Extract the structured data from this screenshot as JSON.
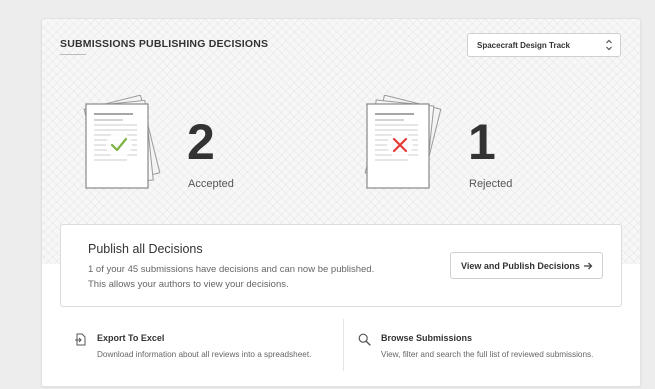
{
  "panel": {
    "title": "SUBMISSIONS PUBLISHING DECISIONS",
    "track_select": {
      "selected": "Spacecraft Design Track"
    }
  },
  "stats": {
    "accepted": {
      "count": "2",
      "label": "Accepted",
      "icon": "document-check-icon",
      "color": "#7cb342"
    },
    "rejected": {
      "count": "1",
      "label": "Rejected",
      "icon": "document-x-icon",
      "color": "#e53935"
    }
  },
  "publish": {
    "title": "Publish all Decisions",
    "description": "1 of your 45 submissions have decisions and can now be published. This allows your authors to view your decisions.",
    "button_label": "View and Publish Decisions",
    "button_icon": "arrow-right-icon"
  },
  "footer": {
    "export": {
      "title": "Export To Excel",
      "description": "Download information about all reviews into a spreadsheet.",
      "icon": "export-file-icon"
    },
    "browse": {
      "title": "Browse Submissions",
      "description": "View, filter and search the full list of reviewed submissions.",
      "icon": "search-icon"
    }
  }
}
